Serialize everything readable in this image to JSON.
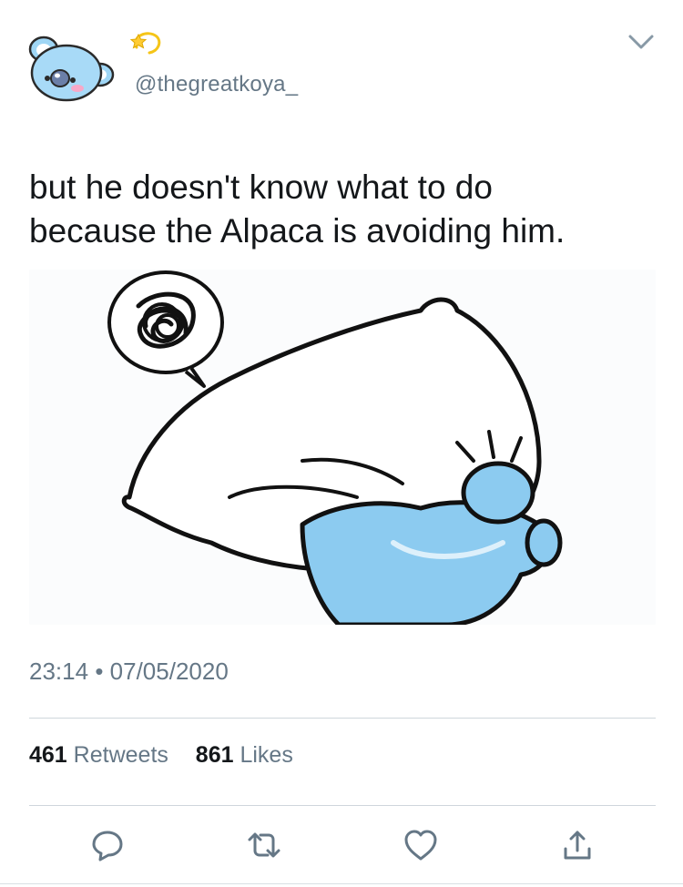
{
  "author": {
    "handle": "@thegreatkoya_",
    "display_name_icon": "dizzy-star-emoji",
    "avatar_icon": "koala-avatar"
  },
  "tweet": {
    "text": "but he doesn't know what to do\nbecause the Alpaca is avoiding him.",
    "media_icon": "koya-hiding-behind-pillow-sticker"
  },
  "meta": {
    "time": "23:14",
    "separator": "•",
    "date": "07/05/2020"
  },
  "stats": {
    "retweets_count": "461",
    "retweets_label": "Retweets",
    "likes_count": "861",
    "likes_label": "Likes"
  },
  "actions": {
    "reply_icon": "reply-icon",
    "retweet_icon": "retweet-icon",
    "like_icon": "heart-icon",
    "share_icon": "share-icon",
    "more_icon": "chevron-down-icon"
  },
  "colors": {
    "text": "#14171a",
    "secondary": "#657786",
    "koala_blue": "#8ccbf0",
    "divider": "#cfd6dc"
  }
}
